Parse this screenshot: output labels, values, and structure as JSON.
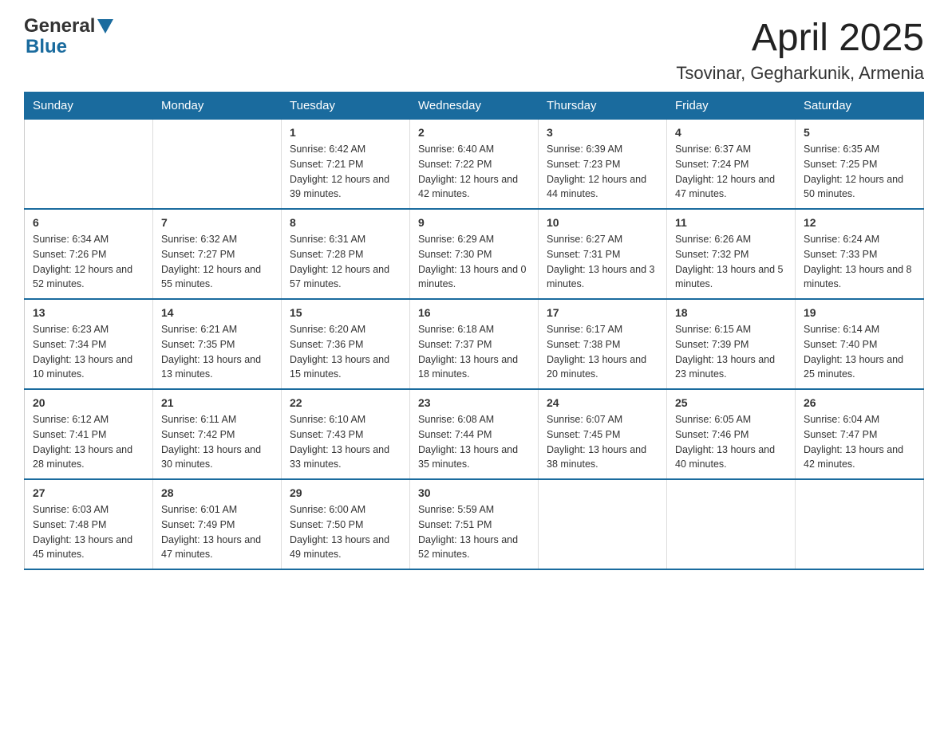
{
  "header": {
    "logo_line1": "General",
    "logo_line2": "Blue",
    "title": "April 2025",
    "subtitle": "Tsovinar, Gegharkunik, Armenia"
  },
  "calendar": {
    "days_of_week": [
      "Sunday",
      "Monday",
      "Tuesday",
      "Wednesday",
      "Thursday",
      "Friday",
      "Saturday"
    ],
    "weeks": [
      {
        "cells": [
          {
            "day": "",
            "info": ""
          },
          {
            "day": "",
            "info": ""
          },
          {
            "day": "1",
            "sunrise": "6:42 AM",
            "sunset": "7:21 PM",
            "daylight": "12 hours and 39 minutes."
          },
          {
            "day": "2",
            "sunrise": "6:40 AM",
            "sunset": "7:22 PM",
            "daylight": "12 hours and 42 minutes."
          },
          {
            "day": "3",
            "sunrise": "6:39 AM",
            "sunset": "7:23 PM",
            "daylight": "12 hours and 44 minutes."
          },
          {
            "day": "4",
            "sunrise": "6:37 AM",
            "sunset": "7:24 PM",
            "daylight": "12 hours and 47 minutes."
          },
          {
            "day": "5",
            "sunrise": "6:35 AM",
            "sunset": "7:25 PM",
            "daylight": "12 hours and 50 minutes."
          }
        ]
      },
      {
        "cells": [
          {
            "day": "6",
            "sunrise": "6:34 AM",
            "sunset": "7:26 PM",
            "daylight": "12 hours and 52 minutes."
          },
          {
            "day": "7",
            "sunrise": "6:32 AM",
            "sunset": "7:27 PM",
            "daylight": "12 hours and 55 minutes."
          },
          {
            "day": "8",
            "sunrise": "6:31 AM",
            "sunset": "7:28 PM",
            "daylight": "12 hours and 57 minutes."
          },
          {
            "day": "9",
            "sunrise": "6:29 AM",
            "sunset": "7:30 PM",
            "daylight": "13 hours and 0 minutes."
          },
          {
            "day": "10",
            "sunrise": "6:27 AM",
            "sunset": "7:31 PM",
            "daylight": "13 hours and 3 minutes."
          },
          {
            "day": "11",
            "sunrise": "6:26 AM",
            "sunset": "7:32 PM",
            "daylight": "13 hours and 5 minutes."
          },
          {
            "day": "12",
            "sunrise": "6:24 AM",
            "sunset": "7:33 PM",
            "daylight": "13 hours and 8 minutes."
          }
        ]
      },
      {
        "cells": [
          {
            "day": "13",
            "sunrise": "6:23 AM",
            "sunset": "7:34 PM",
            "daylight": "13 hours and 10 minutes."
          },
          {
            "day": "14",
            "sunrise": "6:21 AM",
            "sunset": "7:35 PM",
            "daylight": "13 hours and 13 minutes."
          },
          {
            "day": "15",
            "sunrise": "6:20 AM",
            "sunset": "7:36 PM",
            "daylight": "13 hours and 15 minutes."
          },
          {
            "day": "16",
            "sunrise": "6:18 AM",
            "sunset": "7:37 PM",
            "daylight": "13 hours and 18 minutes."
          },
          {
            "day": "17",
            "sunrise": "6:17 AM",
            "sunset": "7:38 PM",
            "daylight": "13 hours and 20 minutes."
          },
          {
            "day": "18",
            "sunrise": "6:15 AM",
            "sunset": "7:39 PM",
            "daylight": "13 hours and 23 minutes."
          },
          {
            "day": "19",
            "sunrise": "6:14 AM",
            "sunset": "7:40 PM",
            "daylight": "13 hours and 25 minutes."
          }
        ]
      },
      {
        "cells": [
          {
            "day": "20",
            "sunrise": "6:12 AM",
            "sunset": "7:41 PM",
            "daylight": "13 hours and 28 minutes."
          },
          {
            "day": "21",
            "sunrise": "6:11 AM",
            "sunset": "7:42 PM",
            "daylight": "13 hours and 30 minutes."
          },
          {
            "day": "22",
            "sunrise": "6:10 AM",
            "sunset": "7:43 PM",
            "daylight": "13 hours and 33 minutes."
          },
          {
            "day": "23",
            "sunrise": "6:08 AM",
            "sunset": "7:44 PM",
            "daylight": "13 hours and 35 minutes."
          },
          {
            "day": "24",
            "sunrise": "6:07 AM",
            "sunset": "7:45 PM",
            "daylight": "13 hours and 38 minutes."
          },
          {
            "day": "25",
            "sunrise": "6:05 AM",
            "sunset": "7:46 PM",
            "daylight": "13 hours and 40 minutes."
          },
          {
            "day": "26",
            "sunrise": "6:04 AM",
            "sunset": "7:47 PM",
            "daylight": "13 hours and 42 minutes."
          }
        ]
      },
      {
        "cells": [
          {
            "day": "27",
            "sunrise": "6:03 AM",
            "sunset": "7:48 PM",
            "daylight": "13 hours and 45 minutes."
          },
          {
            "day": "28",
            "sunrise": "6:01 AM",
            "sunset": "7:49 PM",
            "daylight": "13 hours and 47 minutes."
          },
          {
            "day": "29",
            "sunrise": "6:00 AM",
            "sunset": "7:50 PM",
            "daylight": "13 hours and 49 minutes."
          },
          {
            "day": "30",
            "sunrise": "5:59 AM",
            "sunset": "7:51 PM",
            "daylight": "13 hours and 52 minutes."
          },
          {
            "day": "",
            "info": ""
          },
          {
            "day": "",
            "info": ""
          },
          {
            "day": "",
            "info": ""
          }
        ]
      }
    ]
  }
}
